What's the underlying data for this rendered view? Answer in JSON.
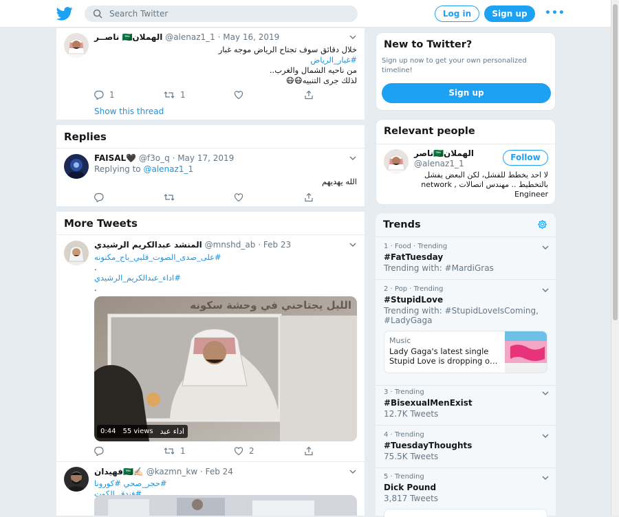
{
  "header": {
    "search_placeholder": "Search Twitter",
    "login_label": "Log in",
    "signup_label": "Sign up",
    "more_label": "•••",
    "accent": "#1da1f2"
  },
  "thread_tweet": {
    "name": "ناصــر 🇸🇦الهملان",
    "handle": "@alenaz1_1",
    "date": "· May 16, 2019",
    "lines": [
      "خلال دقائق سوف تجتاح الرياض موجه غبار",
      "#غبار_الرياض",
      "من ناحيه الشمال والغرب..",
      "لذلك جرى التنبيه😷😷"
    ],
    "reply_count": "1",
    "retweet_count": "1",
    "show_thread": "Show this thread"
  },
  "replies": {
    "title": "Replies",
    "tweet": {
      "name": "FAISAL🖤",
      "handle": "@f3o_q",
      "date": "· May 17, 2019",
      "replying_label": "Replying to",
      "replying_handle": "@alenaz1_1",
      "text": "الله يهديهم"
    }
  },
  "more_tweets": {
    "title": "More Tweets",
    "tweet1": {
      "name": "المنشد عبدالكريم الرشيدي",
      "handle": "@mnshd_ab",
      "date": "· Feb 23",
      "lines": [
        "#على_صدى_الصوت_قلبي_باح_مكنونه",
        ".",
        "#اداء_عبدالكريم_الرشيدي",
        "."
      ],
      "video_caption": "الليل يجتاحني في وحشة سكونه",
      "video_time": "0:44",
      "video_views": "55 views",
      "video_label": "اداء عبد",
      "retweet_count": "1",
      "like_count": "2"
    },
    "tweet2": {
      "name": "فهيدان🇸🇦✍🏻",
      "handle": "@kazmn_kw",
      "date": "· Feb 24",
      "tags": "#حجر_صحي   #كورونا #فندق_الكوت"
    }
  },
  "new_to_twitter": {
    "title": "New to Twitter?",
    "text": "Sign up now to get your own personalized timeline!",
    "button": "Sign up"
  },
  "relevant_people": {
    "title": "Relevant people",
    "name": "ناصر🇸🇦الهملان",
    "handle": "@alenaz1_1",
    "follow_label": "Follow",
    "bio": "لا احد يخطط للفشل، لكن البعض يفشل بالتخطيط .. مهندس اتصالات , network Engineer"
  },
  "trends": {
    "title": "Trends",
    "items": [
      {
        "meta": "1 · Food · Trending",
        "title": "#FatTuesday",
        "sub": "Trending with: #MardiGras"
      },
      {
        "meta": "2 · Pop · Trending",
        "title": "#StupidLove",
        "sub": "Trending with: #StupidLoveIsComing, #LadyGaga"
      },
      {
        "meta": "3 · Trending",
        "title": "#BisexualMenExist",
        "sub": "12.7K Tweets"
      },
      {
        "meta": "4 · Trending",
        "title": "#TuesdayThoughts",
        "sub": "75.5K Tweets"
      },
      {
        "meta": "5 · Trending",
        "title": "Dick Pound",
        "sub": "3,817 Tweets"
      }
    ],
    "card": {
      "category": "Music",
      "text": "Lady Gaga's latest single Stupid Love is dropping o…"
    }
  }
}
